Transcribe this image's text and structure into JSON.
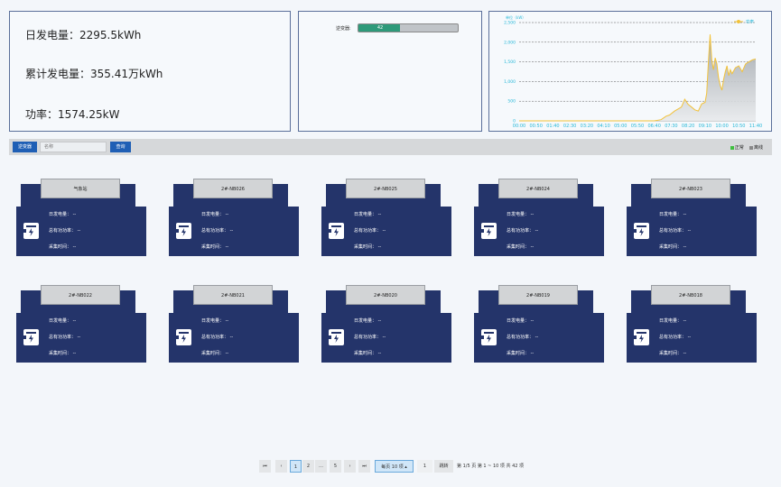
{
  "stats": {
    "daily": "日发电量：2295.5kWh",
    "total": "累计发电量：355.41万kWh",
    "power": "功率：1574.25kW"
  },
  "inverter": {
    "label": "逆变器:",
    "value": "42",
    "fill_fraction": 0.42,
    "fill_color": "#2e9a7a"
  },
  "chart_data": {
    "type": "area",
    "ylabel": "单位（kW）",
    "legend": "功率",
    "ylim": [
      0,
      2500
    ],
    "yticks": [
      0,
      500,
      1000,
      1500,
      2000,
      2500
    ],
    "ytick_labels": [
      "0",
      "500",
      "1,000",
      "1,500",
      "2,000",
      "2,500"
    ],
    "xlim_minutes": [
      0,
      700
    ],
    "xtick_labels": [
      "00:00",
      "00:50",
      "01:40",
      "02:30",
      "03:20",
      "04:10",
      "05:00",
      "05:50",
      "06:40",
      "07:30",
      "08:20",
      "09:10",
      "10:00",
      "10:50",
      "11:40"
    ],
    "x": [
      0,
      50,
      100,
      150,
      200,
      250,
      300,
      350,
      400,
      420,
      435,
      445,
      460,
      470,
      480,
      490,
      500,
      510,
      520,
      530,
      540,
      550,
      555,
      560,
      565,
      570,
      575,
      580,
      585,
      590,
      595,
      600,
      605,
      610,
      615,
      620,
      625,
      630,
      640,
      650,
      660,
      670,
      680,
      690,
      700
    ],
    "y": [
      0,
      0,
      0,
      0,
      0,
      0,
      0,
      0,
      0,
      30,
      120,
      150,
      250,
      300,
      350,
      550,
      420,
      350,
      280,
      250,
      430,
      470,
      700,
      1500,
      2200,
      1550,
      1300,
      1600,
      1450,
      1100,
      900,
      780,
      1050,
      1250,
      1400,
      1150,
      1300,
      1200,
      1350,
      1400,
      1250,
      1450,
      1500,
      1550,
      1574
    ],
    "line_color": "#f2c23a",
    "axis_label_color": "#28b8d8"
  },
  "toolbar": {
    "type_button": "逆变器",
    "search_placeholder": "名称",
    "query_button": "查询",
    "legend_normal": "正常",
    "legend_offline": "离线",
    "normal_color": "#3fbf3f",
    "offline_color": "#888888"
  },
  "card_labels": {
    "daily": "日发电量：",
    "power": "总有功功率：",
    "time": "采集时间：",
    "empty": "--"
  },
  "cards": [
    {
      "name": "气象站"
    },
    {
      "name": "2#-NB026"
    },
    {
      "name": "2#-NB025"
    },
    {
      "name": "2#-NB024"
    },
    {
      "name": "2#-NB023"
    },
    {
      "name": "2#-NB022"
    },
    {
      "name": "2#-NB021"
    },
    {
      "name": "2#-NB020"
    },
    {
      "name": "2#-NB019"
    },
    {
      "name": "2#-NB018"
    }
  ],
  "pagination": {
    "first": "⏮",
    "prev": "‹",
    "pages": [
      "1",
      "2",
      "…",
      "5"
    ],
    "next": "›",
    "last": "⏭",
    "per_page": "每页 10 项 ▴",
    "jump_value": "1",
    "jump_label": "跳转",
    "summary": "第 1/5 页  第 1 ~ 10 项  共 42 项"
  }
}
